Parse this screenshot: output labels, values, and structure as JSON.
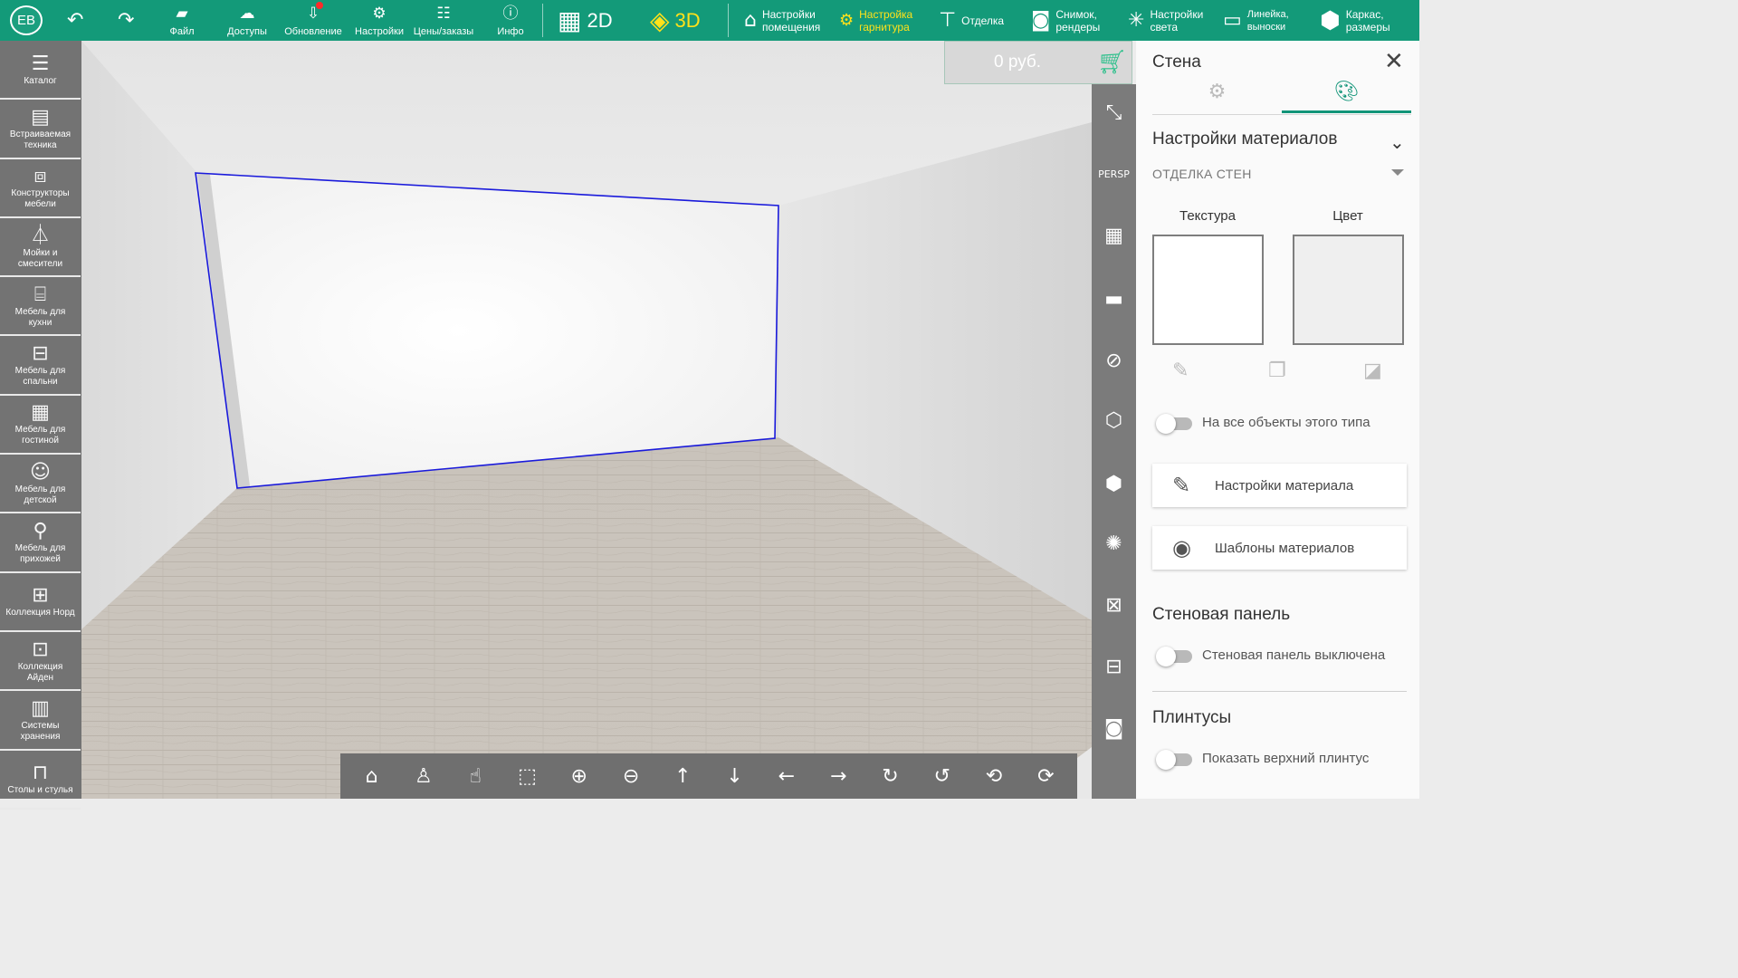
{
  "user": {
    "initials": "EB"
  },
  "toolbar": {
    "undo_icon": "undo-icon",
    "redo_icon": "redo-icon",
    "file": "Файл",
    "access": "Доступы",
    "update": "Обновление",
    "settings": "Настройки",
    "prices": "Цены/заказы",
    "info": "Инфо",
    "view2d": "2D",
    "view3d": "3D",
    "room_settings_1": "Настройки",
    "room_settings_2": "помещения",
    "set_settings_1": "Настройка",
    "set_settings_2": "гарнитура",
    "finish": "Отделка",
    "snapshot_1": "Снимок,",
    "snapshot_2": "рендеры",
    "light_1": "Настройки",
    "light_2": "света",
    "ruler_1": "Линейка,",
    "ruler_2": "выноски",
    "frame_1": "Каркас,",
    "frame_2": "размеры"
  },
  "sidebar": {
    "items": [
      {
        "l1": "Каталог",
        "l2": ""
      },
      {
        "l1": "Встраиваемая",
        "l2": "техника"
      },
      {
        "l1": "Конструкторы",
        "l2": "мебели"
      },
      {
        "l1": "Мойки и",
        "l2": "смесители"
      },
      {
        "l1": "Мебель для",
        "l2": "кухни"
      },
      {
        "l1": "Мебель для",
        "l2": "спальни"
      },
      {
        "l1": "Мебель для",
        "l2": "гостиной"
      },
      {
        "l1": "Мебель для",
        "l2": "детской"
      },
      {
        "l1": "Мебель для",
        "l2": "прихожей"
      },
      {
        "l1": "Коллекция Норд",
        "l2": ""
      },
      {
        "l1": "Коллекция",
        "l2": "Айден"
      },
      {
        "l1": "Системы",
        "l2": "хранения"
      },
      {
        "l1": "Столы и стулья",
        "l2": ""
      }
    ]
  },
  "price": {
    "value": "0 руб."
  },
  "viewstrip": {
    "persp": "PERSP"
  },
  "panel": {
    "title": "Стена",
    "materials_section": "Настройки материалов",
    "wall_finish": "ОТДЕЛКА СТЕН",
    "texture": "Текстура",
    "color": "Цвет",
    "apply_all": "На все объекты этого типа",
    "material_settings": "Настройки материала",
    "material_templates": "Шаблоны материалов",
    "wall_panel_section": "Стеновая панель",
    "wall_panel_off": "Стеновая панель выключена",
    "baseboard_section": "Плинтусы",
    "show_top_baseboard": "Показать верхний плинтус",
    "swatch_color": "#efefef"
  },
  "colors": {
    "primary": "#139a79",
    "accent_yellow": "#ffe11a",
    "selection": "#1a1adb"
  }
}
